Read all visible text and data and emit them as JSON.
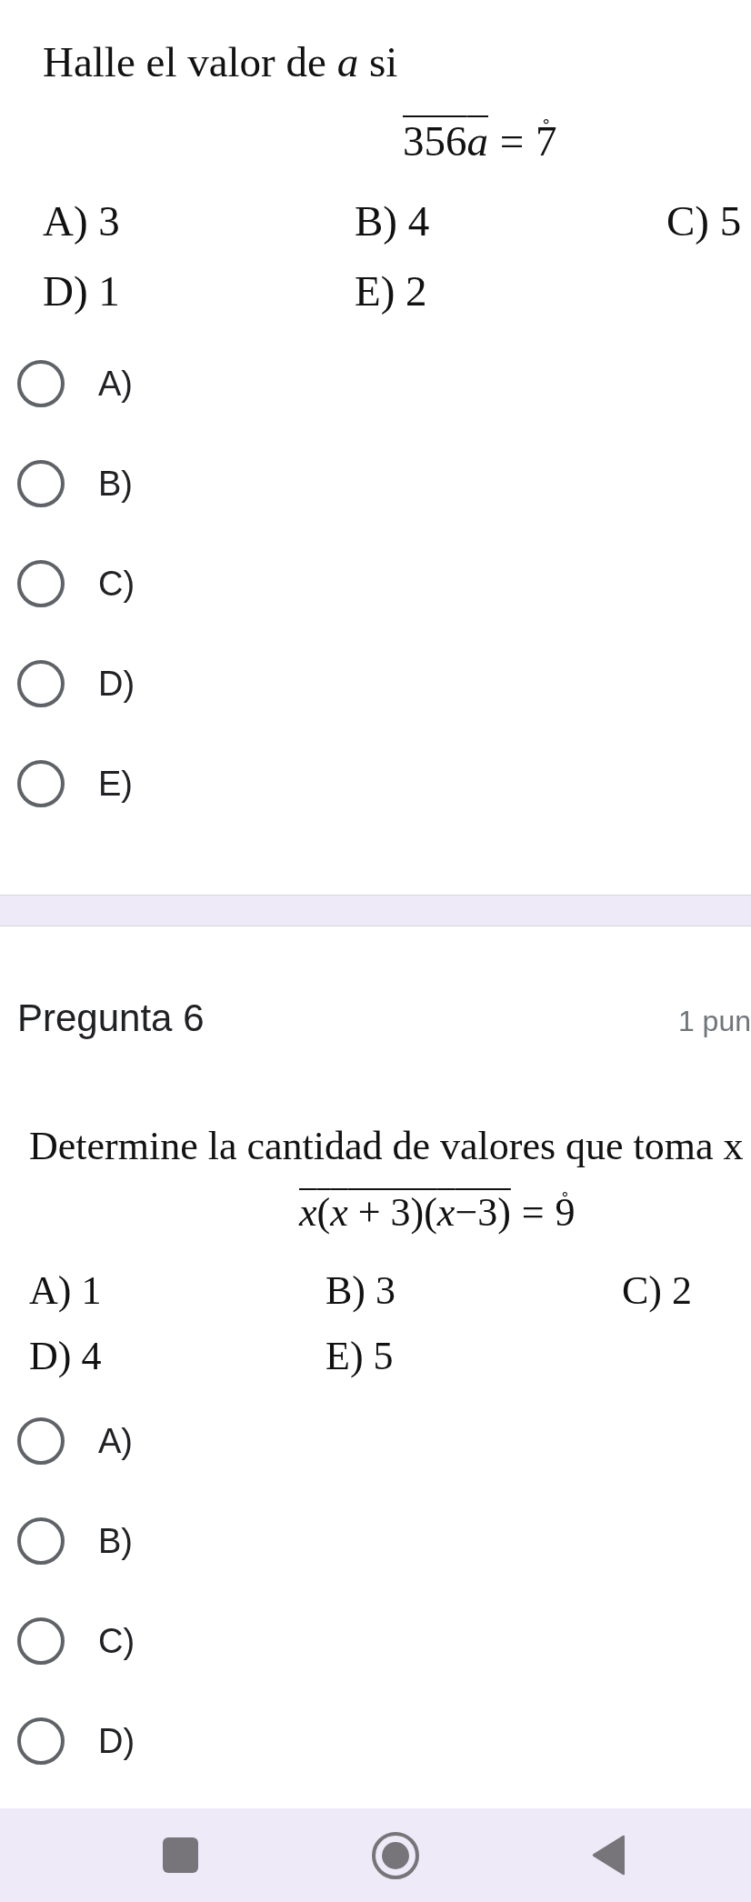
{
  "questions": [
    {
      "prompt": "Halle el valor de *a* si",
      "formula": {
        "lhs": [
          "356",
          "*a*"
        ],
        "relation": "=",
        "rhs": "7",
        "rhs_accent": "˚"
      },
      "choices": [
        "A) 3",
        "B) 4",
        "C) 5",
        "D) 1",
        "E) 2"
      ],
      "options": [
        {
          "label": "A)",
          "selected": false
        },
        {
          "label": "B)",
          "selected": false
        },
        {
          "label": "C)",
          "selected": false
        },
        {
          "label": "D)",
          "selected": false
        },
        {
          "label": "E)",
          "selected": false
        }
      ]
    },
    {
      "title": "Pregunta 6",
      "points": "1 pun",
      "prompt": "Determine la cantidad de valores que toma x",
      "formula": {
        "lhs": [
          "*x*(*x* + 3)(*x*−3)"
        ],
        "relation": "=",
        "rhs": "9",
        "rhs_accent": "˚"
      },
      "choices": [
        "A) 1",
        "B) 3",
        "C) 2",
        "D) 4",
        "E) 5"
      ],
      "options": [
        {
          "label": "A)",
          "selected": false
        },
        {
          "label": "B)",
          "selected": false
        },
        {
          "label": "C)",
          "selected": false
        },
        {
          "label": "D)",
          "selected": false
        }
      ]
    }
  ]
}
